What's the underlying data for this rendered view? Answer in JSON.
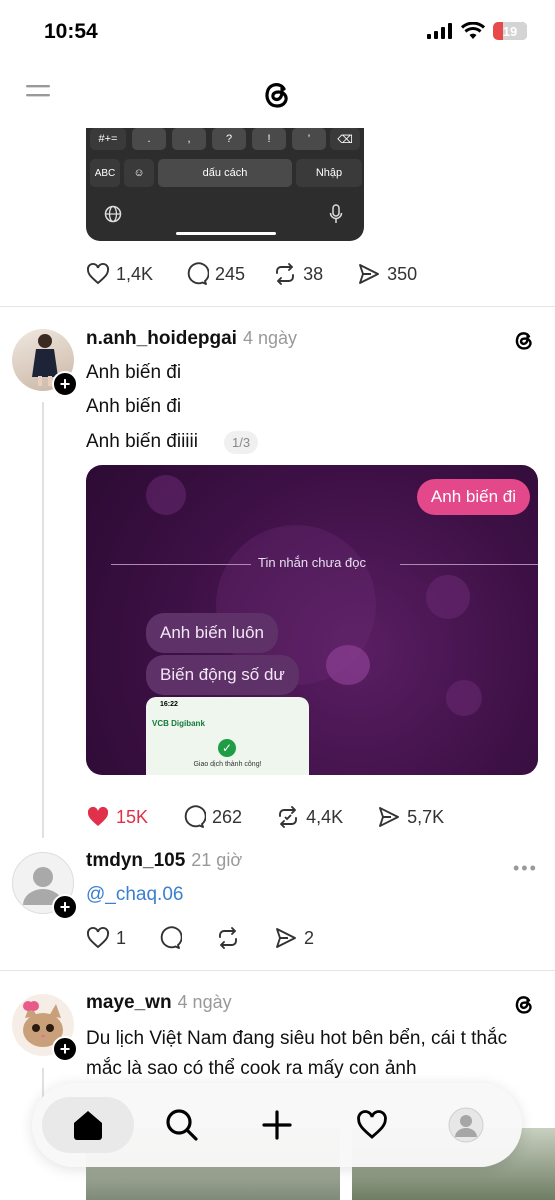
{
  "status_bar": {
    "time": "10:54",
    "battery": "19"
  },
  "keyboard": {
    "symbols": "#+=",
    "keys": [
      ".",
      ",",
      "?",
      "!",
      "’"
    ],
    "abc": "ABC",
    "space": "dấu cách",
    "enter": "Nhập"
  },
  "post1": {
    "likes": "1,4K",
    "replies": "245",
    "reposts": "38",
    "shares": "350"
  },
  "post2": {
    "username": "n.anh_hoidepgai",
    "time": "4 ngày",
    "lines": [
      "Anh biến đi",
      "Anh biến đi",
      "Anh biến điiiii"
    ],
    "page_indicator": "1/3",
    "chat": {
      "sent": "Anh biến đi",
      "unread_label": "Tin nhắn chưa đọc",
      "received": [
        "Anh biến luôn",
        "Biến động số dư"
      ],
      "bank_time": "16:22",
      "bank_name": "VCB Digibank",
      "bank_status": "Giao dịch thành công!"
    },
    "likes": "15K",
    "replies": "262",
    "reposts": "4,4K",
    "shares": "5,7K"
  },
  "post3": {
    "username": "tmdyn_105",
    "time": "21 giờ",
    "mention": "@_chaq.06",
    "likes": "1",
    "shares": "2"
  },
  "post4": {
    "username": "maye_wn",
    "time": "4 ngày",
    "text": "Du lịch Việt Nam đang siêu hot bên bển, cái t thắc mắc là sao có thể cook ra mấy con ảnh"
  },
  "colors": {
    "like_active": "#e0304a",
    "mention": "#3b7fd0",
    "chat_sent": "#e2488a"
  },
  "icons": [
    "menu-icon",
    "threads-logo-icon",
    "heart-icon",
    "comment-icon",
    "repost-icon",
    "share-icon",
    "home-icon",
    "search-icon",
    "plus-icon",
    "profile-icon"
  ]
}
